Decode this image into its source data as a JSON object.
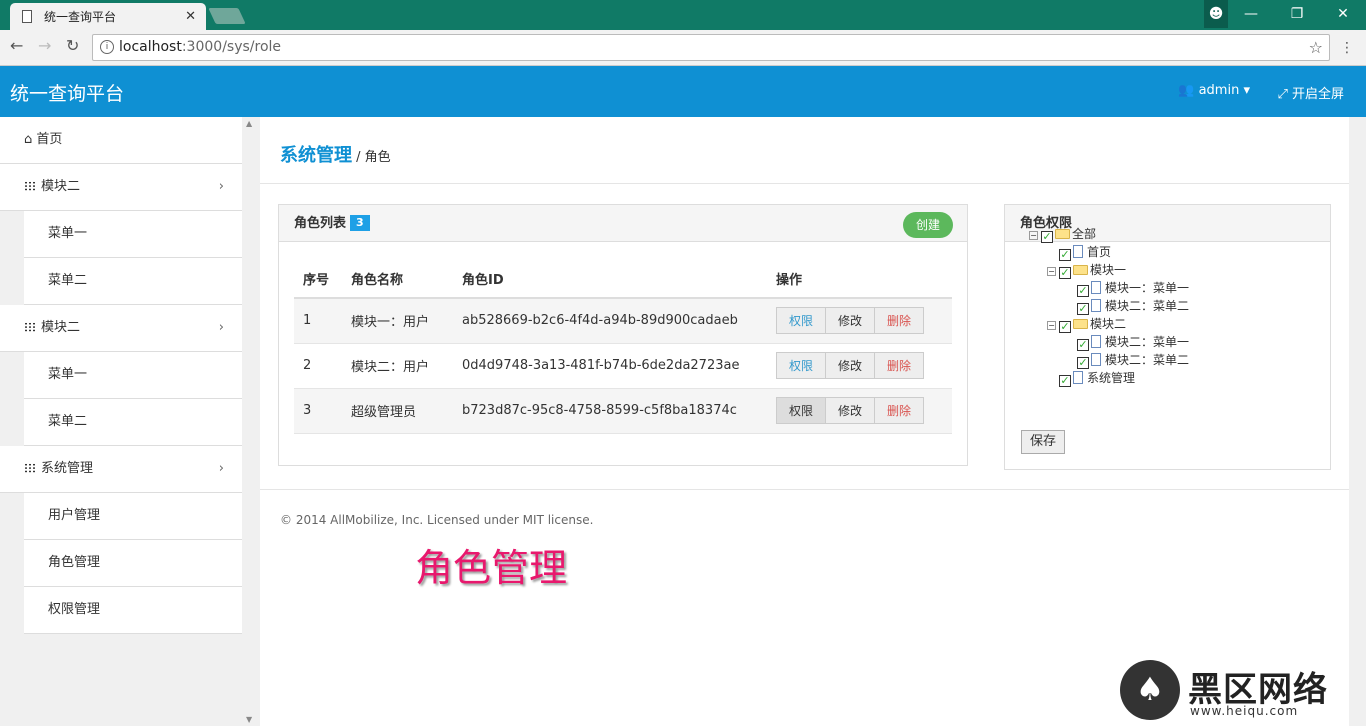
{
  "browser": {
    "tab_title": "统一查询平台",
    "tab_close": "✕",
    "url_host": "localhost",
    "url_rest": ":3000/sys/role",
    "window_buttons": [
      "—",
      "❐",
      "✕"
    ]
  },
  "header": {
    "title": "统一查询平台",
    "user": "admin",
    "fullscreen": "开启全屏"
  },
  "sidebar": {
    "home": "首页",
    "module2_a": "模块二",
    "menu1_a": "菜单一",
    "menu2_a": "菜单二",
    "module2_b": "模块二",
    "menu1_b": "菜单一",
    "menu2_b": "菜单二",
    "sysmgmt": "系统管理",
    "user_mgmt": "用户管理",
    "role_mgmt": "角色管理",
    "perm_mgmt": "权限管理"
  },
  "breadcrumb": {
    "section": "系统管理",
    "sep": " / ",
    "page": "角色"
  },
  "role_list": {
    "title": "角色列表",
    "count": "3",
    "create": "创建",
    "columns": [
      "序号",
      "角色名称",
      "角色ID",
      "操作"
    ],
    "rows": [
      {
        "no": "1",
        "name": "模块一：用户",
        "id": "ab528669-b2c6-4f4d-a94b-89d900cadaeb"
      },
      {
        "no": "2",
        "name": "模块二：用户",
        "id": "0d4d9748-3a13-481f-b74b-6de2da2723ae"
      },
      {
        "no": "3",
        "name": "超级管理员",
        "id": "b723d87c-95c8-4758-8599-c5f8ba18374c"
      }
    ],
    "actions": {
      "perm": "权限",
      "edit": "修改",
      "del": "删除"
    }
  },
  "role_perm": {
    "title": "角色权限",
    "tree": {
      "all": "全部",
      "home": "首页",
      "m1": "模块一",
      "m1_1": "模块一：菜单一",
      "m1_2": "模块二：菜单二",
      "m2": "模块二",
      "m2_1": "模块二：菜单一",
      "m2_2": "模块二：菜单二",
      "sys": "系统管理"
    },
    "save": "保存"
  },
  "footer": "© 2014 AllMobilize, Inc. Licensed under MIT license.",
  "overlay_caption": "角色管理",
  "watermark": {
    "text": "黑区网络",
    "sub": "www.heiqu.com"
  }
}
